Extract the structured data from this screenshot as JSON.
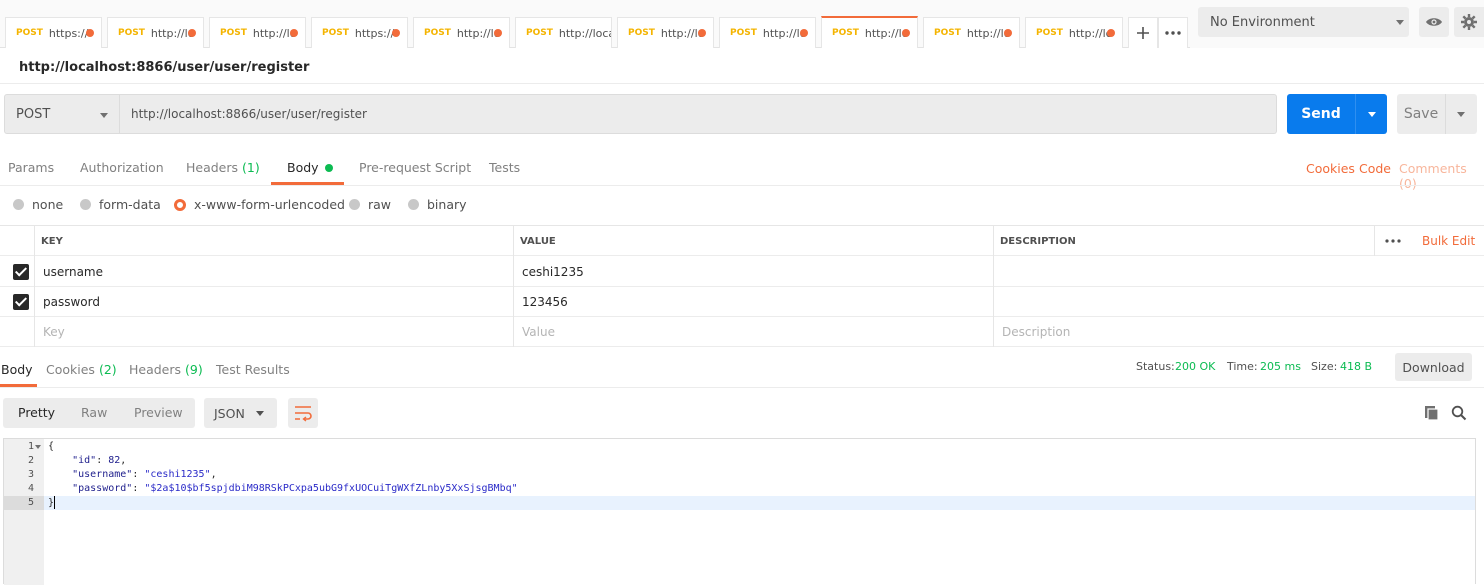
{
  "tabs": [
    {
      "method": "POST",
      "url": "https://"
    },
    {
      "method": "POST",
      "url": "http://lc"
    },
    {
      "method": "POST",
      "url": "http://lc"
    },
    {
      "method": "POST",
      "url": "https://"
    },
    {
      "method": "POST",
      "url": "http://lc"
    },
    {
      "method": "POST",
      "url": "http://local"
    },
    {
      "method": "POST",
      "url": "http://lc"
    },
    {
      "method": "POST",
      "url": "http://lc"
    },
    {
      "method": "POST",
      "url": "http://lc"
    },
    {
      "method": "POST",
      "url": "http://lc"
    },
    {
      "method": "POST",
      "url": "http://lc"
    }
  ],
  "environment": {
    "selected": "No Environment"
  },
  "request": {
    "title": "http://localhost:8866/user/user/register",
    "method": "POST",
    "url": "http://localhost:8866/user/user/register",
    "send_label": "Send",
    "save_label": "Save"
  },
  "request_tabs": {
    "params": "Params",
    "authorization": "Authorization",
    "headers": "Headers",
    "headers_count": "(1)",
    "body": "Body",
    "prerequest": "Pre-request Script",
    "tests": "Tests"
  },
  "right_links": {
    "cookies": "Cookies",
    "code": "Code",
    "comments": "Comments (0)"
  },
  "body_modes": {
    "none": "none",
    "form_data": "form-data",
    "urlencoded": "x-www-form-urlencoded",
    "raw": "raw",
    "binary": "binary"
  },
  "kv": {
    "header_key": "KEY",
    "header_value": "VALUE",
    "header_desc": "DESCRIPTION",
    "bulk_edit": "Bulk Edit",
    "rows": [
      {
        "key": "username",
        "value": "ceshi1235"
      },
      {
        "key": "password",
        "value": "123456"
      }
    ],
    "placeholder_key": "Key",
    "placeholder_value": "Value",
    "placeholder_desc": "Description"
  },
  "response_tabs": {
    "body": "Body",
    "cookies": "Cookies",
    "cookies_count": "(2)",
    "headers": "Headers",
    "headers_count": "(9)",
    "test_results": "Test Results"
  },
  "status": {
    "status_label": "Status:",
    "status_value": "200 OK",
    "time_label": "Time:",
    "time_value": "205 ms",
    "size_label": "Size:",
    "size_value": "418 B",
    "download": "Download"
  },
  "format": {
    "pretty": "Pretty",
    "raw": "Raw",
    "preview": "Preview",
    "type": "JSON"
  },
  "response_body": {
    "lines": [
      "1",
      "2",
      "3",
      "4",
      "5"
    ],
    "open": "{",
    "close": "}",
    "id_key": "\"id\"",
    "id_val": "82",
    "username_key": "\"username\"",
    "username_val": "\"ceshi1235\"",
    "password_key": "\"password\"",
    "password_val": "\"$2a$10$bf5spjdbiM98RSkPCxpa5ubG9fxUOCuiTgWXfZLnby5XxSjsgBMbq\""
  },
  "colors": {
    "accent": "#f26b3a",
    "send": "#097bed",
    "method_tab": "#f4b400",
    "status_ok": "#0cbb52"
  }
}
